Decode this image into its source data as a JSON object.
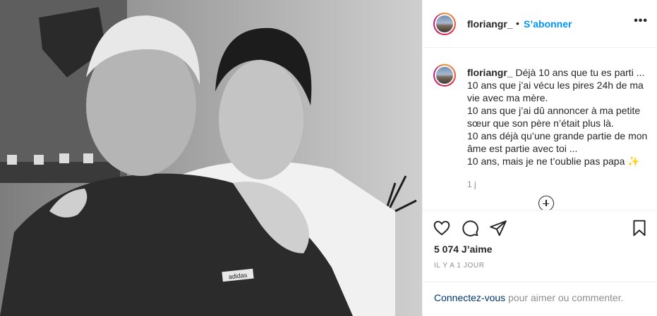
{
  "post": {
    "image_icon": "photo-placeholder",
    "image_jersey_text": "adidas"
  },
  "header": {
    "username": "floriangr_",
    "separator": "•",
    "follow_label": "S’abonner",
    "more_label": "•••"
  },
  "caption": {
    "username": "floriangr_",
    "text": "Déjà 10 ans que tu es parti ...\n10 ans que j’ai vécu les pires 24h de ma vie avec ma mère.\n10 ans que j’ai dû annoncer à ma petite sœur que son père n’était plus là.\n10 ans déjà qu’une grande partie de mon âme est partie avec toi ...\n10 ans, mais je ne t’oublie pas papa ✨",
    "time_ago": "1 j",
    "load_more_icon": "plus-circle-icon"
  },
  "actions": {
    "icons": [
      "heart-icon",
      "comment-icon",
      "share-icon",
      "bookmark-icon"
    ],
    "likes": "5 074 J’aime",
    "date": "il y a 1 jour"
  },
  "footer": {
    "login_link": "Connectez-vous",
    "login_text": " pour aimer ou commenter."
  },
  "colors": {
    "accent": "#0095f6",
    "text": "#262626",
    "muted": "#8e8e8e",
    "border": "#efefef",
    "link_dark": "#00376b"
  }
}
